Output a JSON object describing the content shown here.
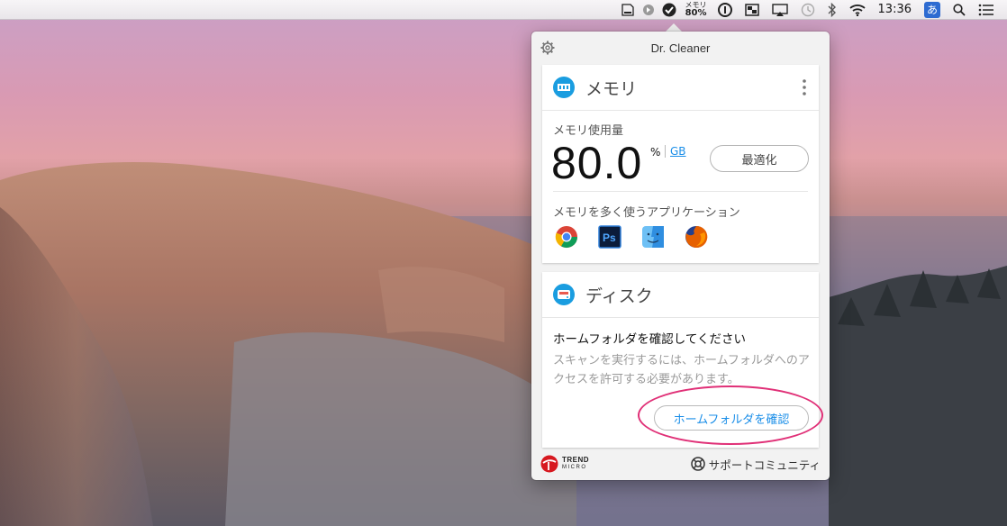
{
  "menubar": {
    "memory_label": "メモリ",
    "memory_percent": "80%",
    "time": "13:36",
    "input_method": "あ",
    "icons": [
      "disk-icon",
      "circle-arrow-icon",
      "dr-cleaner-icon",
      "info-lock-icon",
      "display-icon",
      "airplay-icon",
      "time-machine-icon",
      "bluetooth-icon",
      "wifi-icon",
      "spotlight-icon",
      "notification-list-icon"
    ]
  },
  "popover": {
    "title": "Dr. Cleaner",
    "memory_card": {
      "title": "メモリ",
      "usage_label": "メモリ使用量",
      "usage_value": "80.0",
      "unit_percent": "%",
      "unit_gb": "GB",
      "optimize_label": "最適化",
      "apps_label": "メモリを多く使うアプリケーション",
      "apps": [
        "Google Chrome",
        "Photoshop",
        "Finder",
        "Firefox"
      ]
    },
    "disk_card": {
      "title": "ディスク",
      "heading": "ホームフォルダを確認してください",
      "description": "スキャンを実行するには、ホームフォルダへのアクセスを許可する必要があります。",
      "confirm_label": "ホームフォルダを確認"
    },
    "footer": {
      "brand_line1": "TREND",
      "brand_line2": "MICRO",
      "support_label": "サポートコミュニティ"
    }
  },
  "colors": {
    "accent": "#1a8ee8",
    "highlight_ring": "#e03077",
    "card_icon": "#1a9de0"
  }
}
